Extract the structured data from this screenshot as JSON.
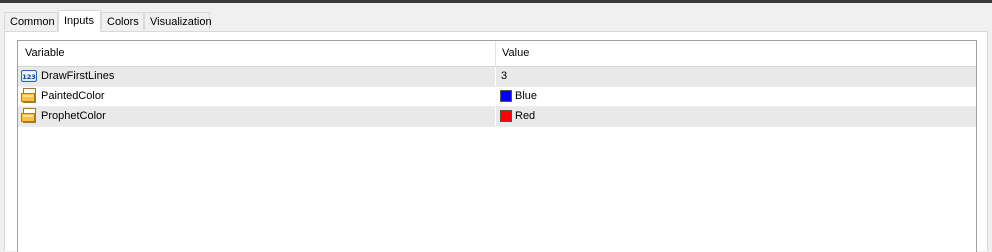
{
  "tabs": [
    {
      "label": "Common",
      "active": false
    },
    {
      "label": "Inputs",
      "active": true
    },
    {
      "label": "Colors",
      "active": false
    },
    {
      "label": "Visualization",
      "active": false
    }
  ],
  "grid": {
    "columns": [
      "Variable",
      "Value"
    ],
    "rows": [
      {
        "name": "DrawFirstLines",
        "value": "3",
        "icon": "integer-icon"
      },
      {
        "name": "PaintedColor",
        "value": "Blue",
        "icon": "color-input-icon",
        "color": "#0000ff"
      },
      {
        "name": "ProphetColor",
        "value": "Red",
        "icon": "color-input-icon",
        "color": "#ff0000"
      }
    ]
  }
}
